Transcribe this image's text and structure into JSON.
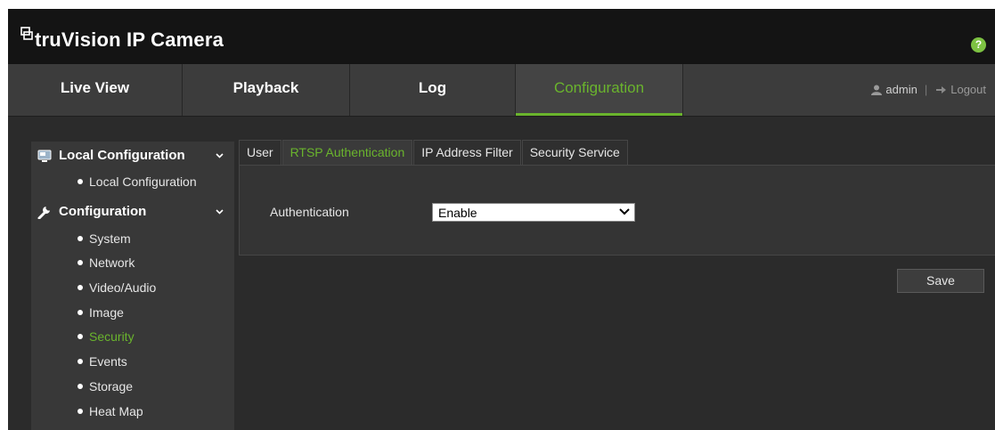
{
  "header": {
    "brand": "truVision IP Camera",
    "help_label": "?"
  },
  "nav": {
    "tabs": [
      {
        "label": "Live View"
      },
      {
        "label": "Playback"
      },
      {
        "label": "Log"
      },
      {
        "label": "Configuration",
        "active": true
      }
    ],
    "user": "admin",
    "logout": "Logout"
  },
  "sidebar": {
    "groups": [
      {
        "label": "Local Configuration",
        "icon": "computer-icon",
        "items": [
          {
            "label": "Local Configuration"
          }
        ]
      },
      {
        "label": "Configuration",
        "icon": "wrench-icon",
        "items": [
          {
            "label": "System"
          },
          {
            "label": "Network"
          },
          {
            "label": "Video/Audio"
          },
          {
            "label": "Image"
          },
          {
            "label": "Security",
            "active": true
          },
          {
            "label": "Events"
          },
          {
            "label": "Storage"
          },
          {
            "label": "Heat Map"
          }
        ]
      }
    ]
  },
  "content": {
    "tabs": [
      {
        "label": "User"
      },
      {
        "label": "RTSP Authentication",
        "active": true
      },
      {
        "label": "IP Address Filter"
      },
      {
        "label": "Security Service"
      }
    ],
    "authentication": {
      "label": "Authentication",
      "value": "Enable"
    },
    "save_label": "Save"
  },
  "colors": {
    "accent": "#6ab42d",
    "help": "#7dc242"
  }
}
